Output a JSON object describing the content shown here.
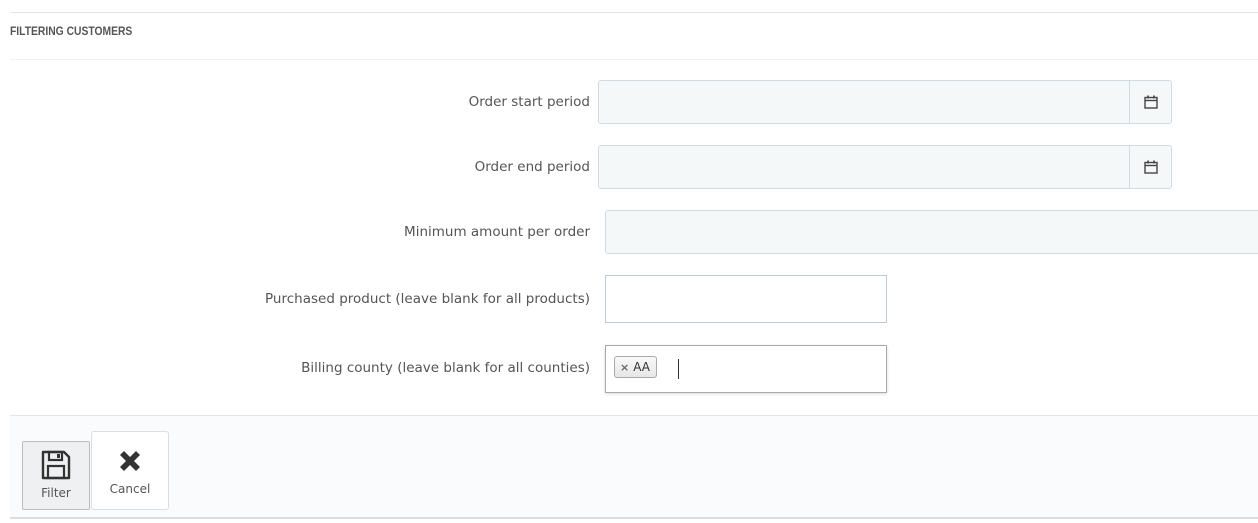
{
  "panel": {
    "title": "FILTERING CUSTOMERS"
  },
  "form": {
    "order_start": {
      "label": "Order start period",
      "value": "",
      "icon": "calendar-icon"
    },
    "order_end": {
      "label": "Order end period",
      "value": "",
      "icon": "calendar-icon"
    },
    "min_amount": {
      "label": "Minimum amount per order",
      "value": ""
    },
    "purchased_product": {
      "label": "Purchased product (leave blank for all products)",
      "value": ""
    },
    "billing_county": {
      "label": "Billing county (leave blank for all counties)",
      "tags": [
        "AA"
      ],
      "tag_remove_glyph": "×"
    }
  },
  "footer": {
    "filter_label": "Filter",
    "filter_icon": "floppy-disk-icon",
    "cancel_label": "Cancel",
    "cancel_icon": "close-icon"
  },
  "colors": {
    "field_bg": "#f5f8f9",
    "field_border": "#cfdde2",
    "text": "#555555"
  }
}
